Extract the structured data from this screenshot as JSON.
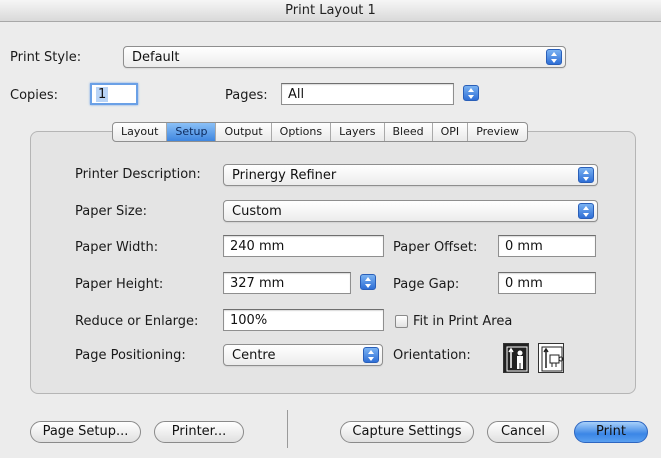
{
  "window": {
    "title": "Print Layout 1"
  },
  "print_style": {
    "label": "Print Style:",
    "value": "Default"
  },
  "copies": {
    "label": "Copies:",
    "value": "1"
  },
  "pages": {
    "label": "Pages:",
    "value": "All"
  },
  "tabs": [
    {
      "label": "Layout",
      "active": false
    },
    {
      "label": "Setup",
      "active": true
    },
    {
      "label": "Output",
      "active": false
    },
    {
      "label": "Options",
      "active": false
    },
    {
      "label": "Layers",
      "active": false
    },
    {
      "label": "Bleed",
      "active": false
    },
    {
      "label": "OPI",
      "active": false
    },
    {
      "label": "Preview",
      "active": false
    }
  ],
  "setup": {
    "printer_description": {
      "label": "Printer Description:",
      "value": "Prinergy Refiner"
    },
    "paper_size": {
      "label": "Paper Size:",
      "value": "Custom"
    },
    "paper_width": {
      "label": "Paper Width:",
      "value": "240 mm"
    },
    "paper_offset": {
      "label": "Paper Offset:",
      "value": "0 mm"
    },
    "paper_height": {
      "label": "Paper Height:",
      "value": "327 mm"
    },
    "page_gap": {
      "label": "Page Gap:",
      "value": "0 mm"
    },
    "reduce_enlarge": {
      "label": "Reduce or Enlarge:",
      "value": "100%"
    },
    "fit_in_print_area": {
      "label": "Fit in Print Area",
      "checked": false
    },
    "page_positioning": {
      "label": "Page Positioning:",
      "value": "Centre"
    },
    "orientation": {
      "label": "Orientation:",
      "selected": "portrait",
      "icons": [
        "portrait-orientation-icon",
        "landscape-orientation-icon"
      ]
    }
  },
  "buttons": {
    "page_setup": "Page Setup...",
    "printer": "Printer...",
    "capture_settings": "Capture Settings",
    "cancel": "Cancel",
    "print": "Print"
  },
  "colors": {
    "accent": "#3b86e6",
    "selection": "#b9d4f6"
  }
}
